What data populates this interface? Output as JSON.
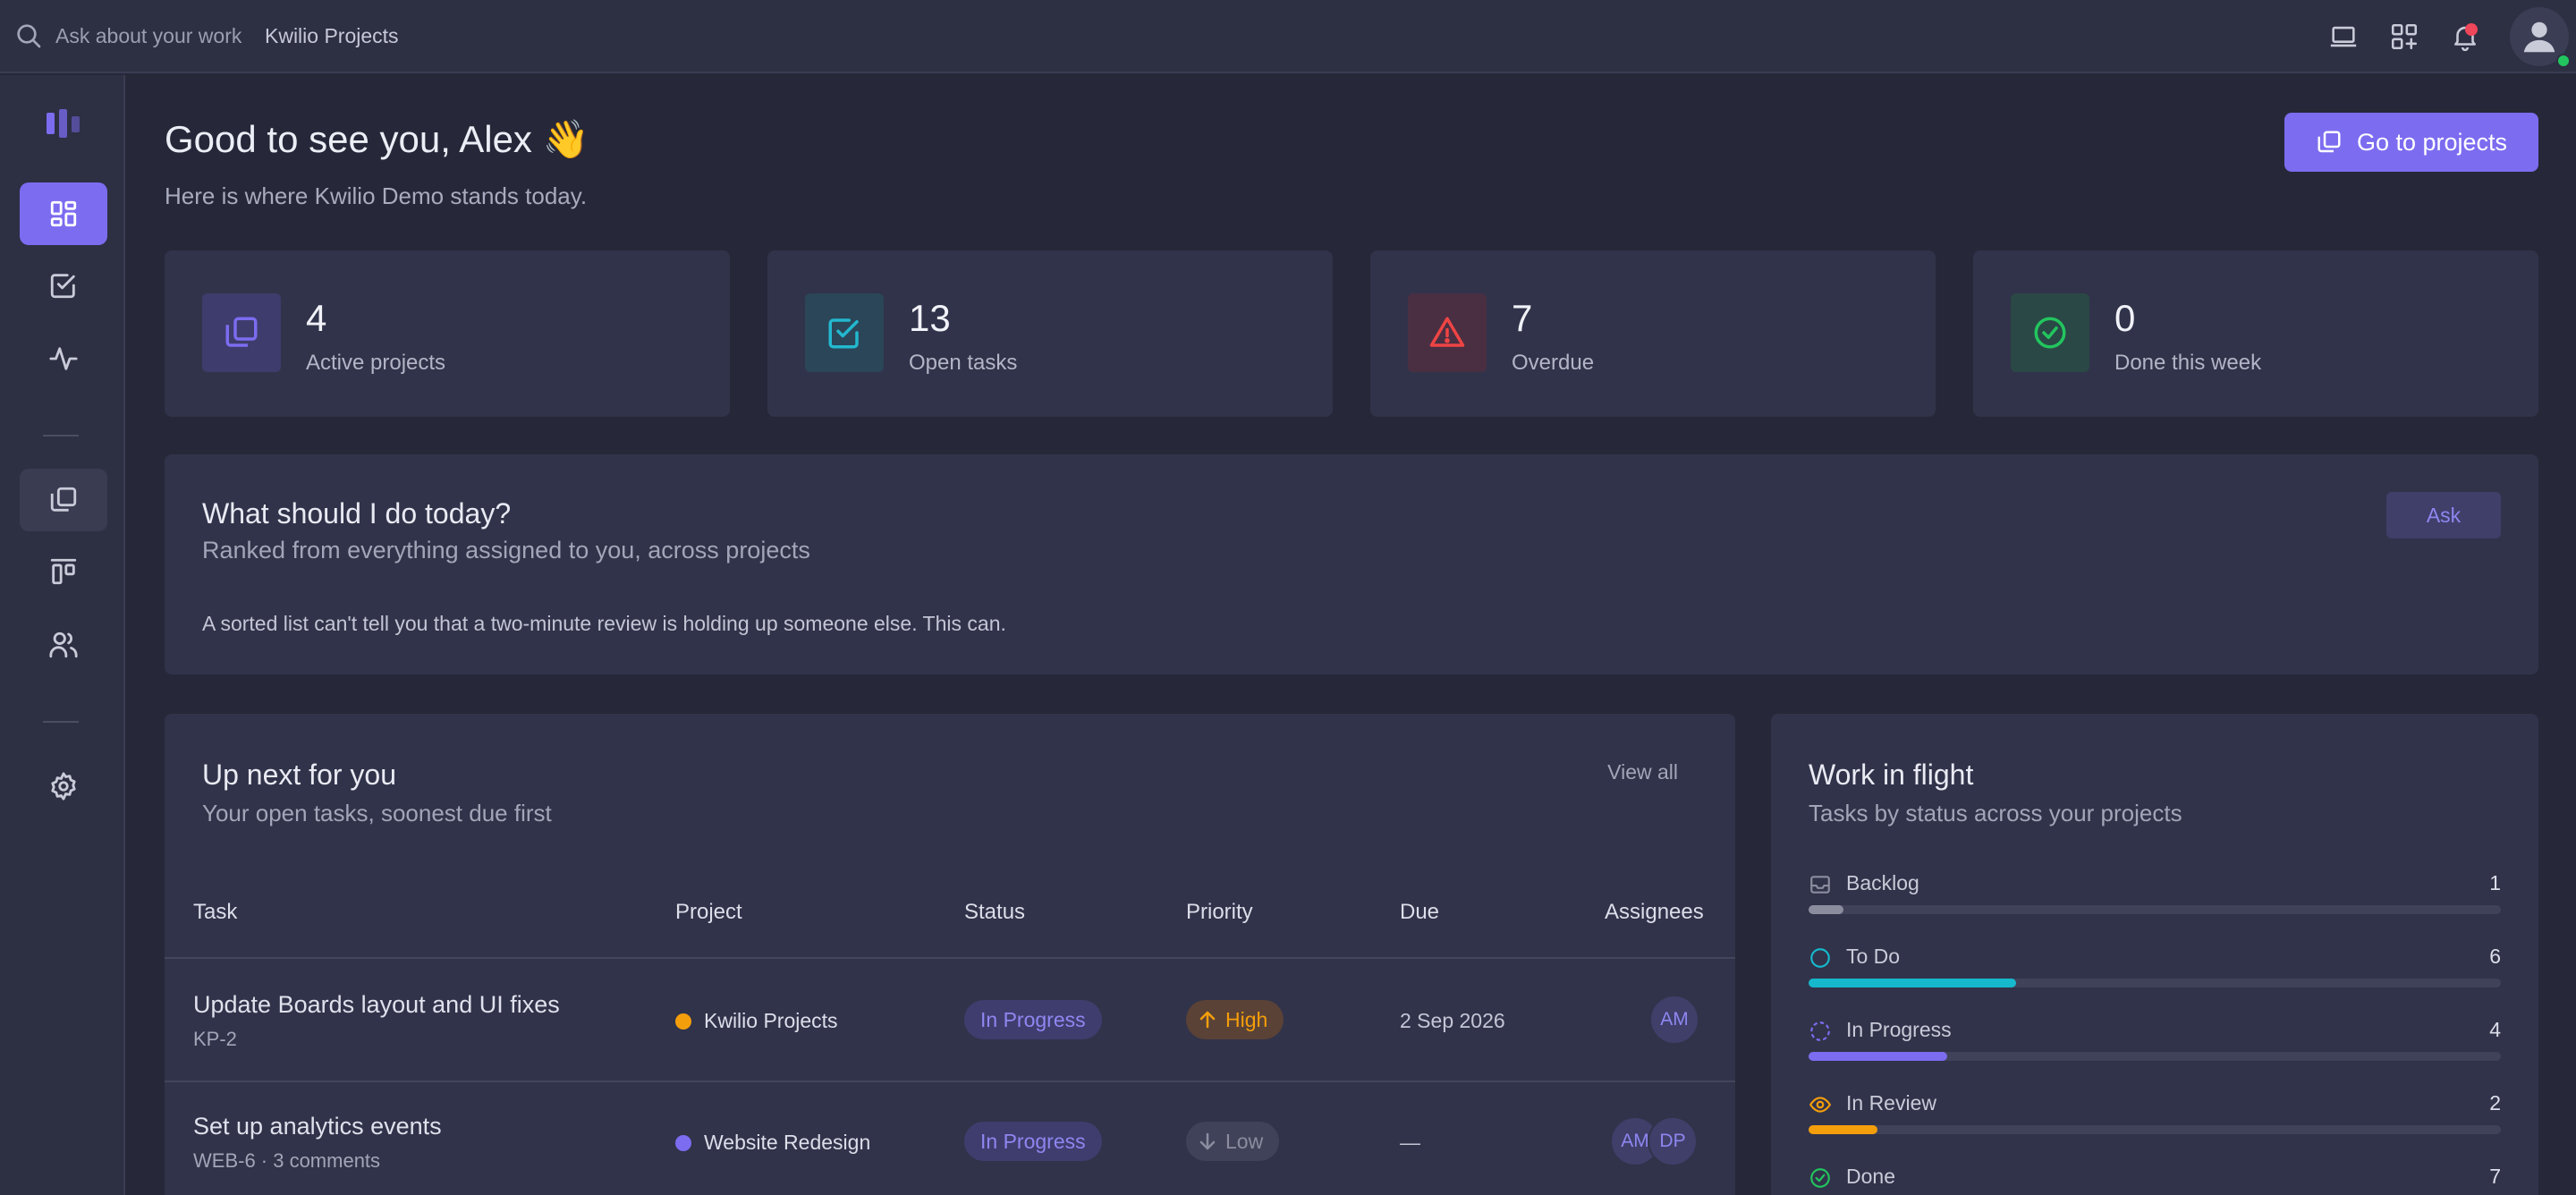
{
  "topbar": {
    "search_placeholder": "Ask about your work",
    "workspace": "Kwilio Projects"
  },
  "main": {
    "greeting": "Good to see you, Alex 👋",
    "subtitle": "Here is where Kwilio Demo stands today.",
    "goto_label": "Go to projects"
  },
  "stats": [
    {
      "value": "4",
      "label": "Active projects",
      "color": "#7c6cf0"
    },
    {
      "value": "13",
      "label": "Open tasks",
      "color": "#22b8cf"
    },
    {
      "value": "7",
      "label": "Overdue",
      "color": "#ef4444"
    },
    {
      "value": "0",
      "label": "Done this week",
      "color": "#22c55e"
    }
  ],
  "ask": {
    "title": "What should I do today?",
    "subtitle": "Ranked from everything assigned to you, across projects",
    "button": "Ask",
    "note": "A sorted list can't tell you that a two-minute review is holding up someone else. This can."
  },
  "tasks": {
    "title": "Up next for you",
    "subtitle": "Your open tasks, soonest due first",
    "view_all": "View all",
    "columns": [
      "Task",
      "Project",
      "Status",
      "Priority",
      "Due",
      "Assignees"
    ],
    "rows": [
      {
        "name": "Update Boards layout and UI fixes",
        "meta": "KP-2",
        "project": "Kwilio Projects",
        "project_color": "#f59e0b",
        "status": "In Progress",
        "priority": "High",
        "due": "2 Sep 2026",
        "assignees": [
          "AM"
        ]
      },
      {
        "name": "Set up analytics events",
        "meta": "WEB-6 · 3 comments",
        "project": "Website Redesign",
        "project_color": "#7c6cf0",
        "status": "In Progress",
        "priority": "Low",
        "due": "—",
        "assignees": [
          "AM",
          "DP"
        ]
      }
    ]
  },
  "flight": {
    "title": "Work in flight",
    "subtitle": "Tasks by status across your projects",
    "max": 20,
    "items": [
      {
        "label": "Backlog",
        "count": "1",
        "value": 1,
        "color": "#8b8d9f",
        "icon": "inbox-icon"
      },
      {
        "label": "To Do",
        "count": "6",
        "value": 6,
        "color": "#16b8cc",
        "icon": "circle-icon"
      },
      {
        "label": "In Progress",
        "count": "4",
        "value": 4,
        "color": "#7c6cf0",
        "icon": "dashed-circle-icon"
      },
      {
        "label": "In Review",
        "count": "2",
        "value": 2,
        "color": "#f59e0b",
        "icon": "eye-icon"
      },
      {
        "label": "Done",
        "count": "7",
        "value": 7,
        "color": "#22c55e",
        "icon": "check-circle-icon"
      }
    ]
  },
  "colors": {
    "accent": "#7c6cf0",
    "high_priority": "#f59e0b",
    "low_priority": "#8b8d9f"
  }
}
